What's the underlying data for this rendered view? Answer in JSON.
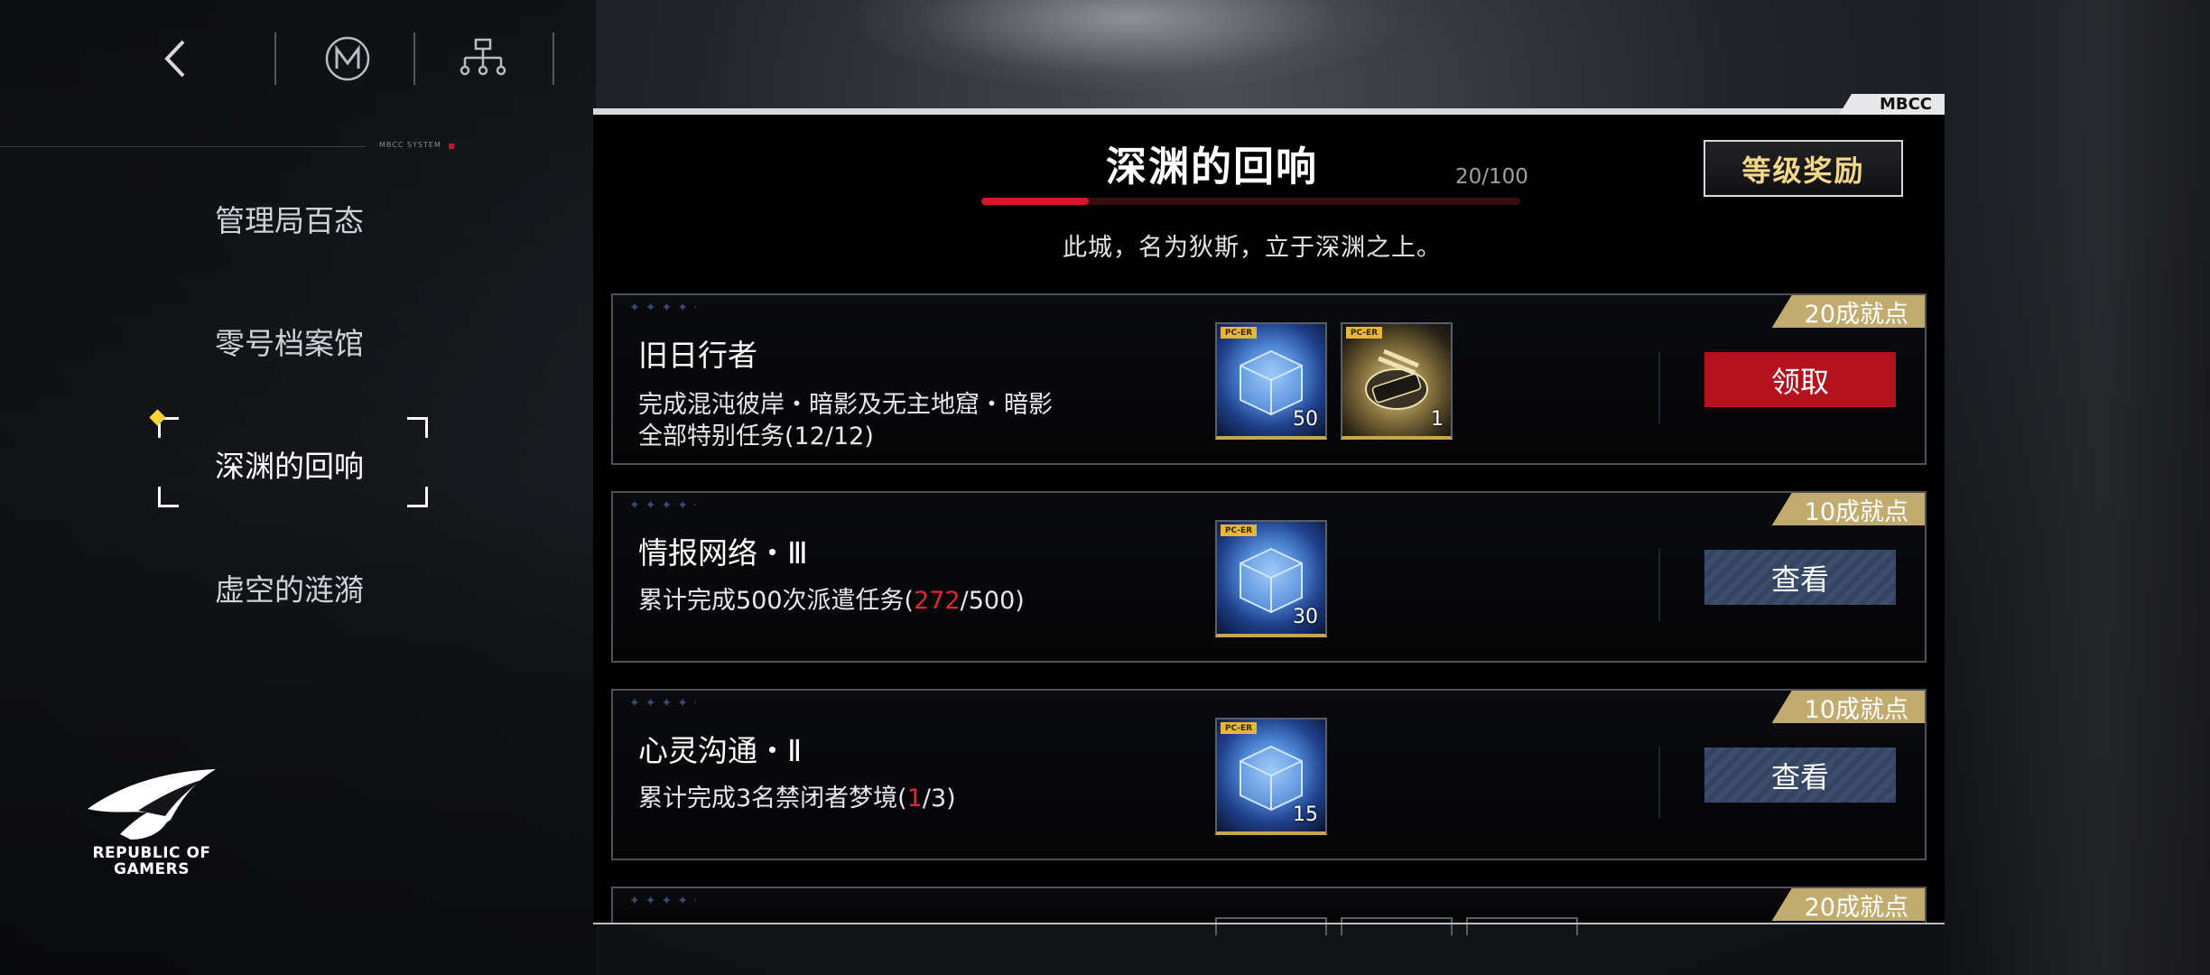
{
  "nav": {
    "back_icon": "chevron-left-icon",
    "m_logo_icon": "m-emblem-icon",
    "hierarchy_icon": "hierarchy-icon"
  },
  "sidebar": {
    "system_label": "MBCC SYSTEM",
    "items": [
      {
        "label": "管理局百态"
      },
      {
        "label": "零号档案馆"
      },
      {
        "label": "深渊的回响",
        "active": true
      },
      {
        "label": "虚空的涟漪"
      }
    ]
  },
  "brand": {
    "line1": "REPUBLIC OF",
    "line2": "GAMERS"
  },
  "panel": {
    "tag": "MBCC",
    "title": "深渊的回响",
    "progress_text": "20/100",
    "progress_fraction": 0.2,
    "subtitle": "此城，名为狄斯，立于深渊之上。",
    "reward_button": "等级奖励",
    "colors": {
      "accent_red": "#d4152b",
      "gold": "#c2ab6e"
    }
  },
  "tasks": [
    {
      "title": "旧日行者",
      "desc": "完成混沌彼岸・暗影及无主地窟・暗影全部特别任务(12/12)",
      "badge": "20成就点",
      "rewards": [
        {
          "type": "cube",
          "tag": "PC-ER",
          "count": "50"
        },
        {
          "type": "classified",
          "tag": "PC-ER",
          "count": "1"
        }
      ],
      "button": "领取",
      "button_style": "red"
    },
    {
      "title": "情报网络・Ⅲ",
      "desc_prefix": "累计完成500次派遣任务(",
      "desc_hl": "272",
      "desc_suffix": "/500)",
      "badge": "10成就点",
      "rewards": [
        {
          "type": "cube",
          "tag": "PC-ER",
          "count": "30"
        }
      ],
      "button": "查看",
      "button_style": "blue"
    },
    {
      "title": "心灵沟通・Ⅱ",
      "desc_prefix": "累计完成3名禁闭者梦境(",
      "desc_hl": "1",
      "desc_suffix": "/3)",
      "badge": "10成就点",
      "rewards": [
        {
          "type": "cube",
          "tag": "PC-ER",
          "count": "15"
        }
      ],
      "button": "查看",
      "button_style": "blue"
    },
    {
      "badge": "20成就点"
    }
  ]
}
